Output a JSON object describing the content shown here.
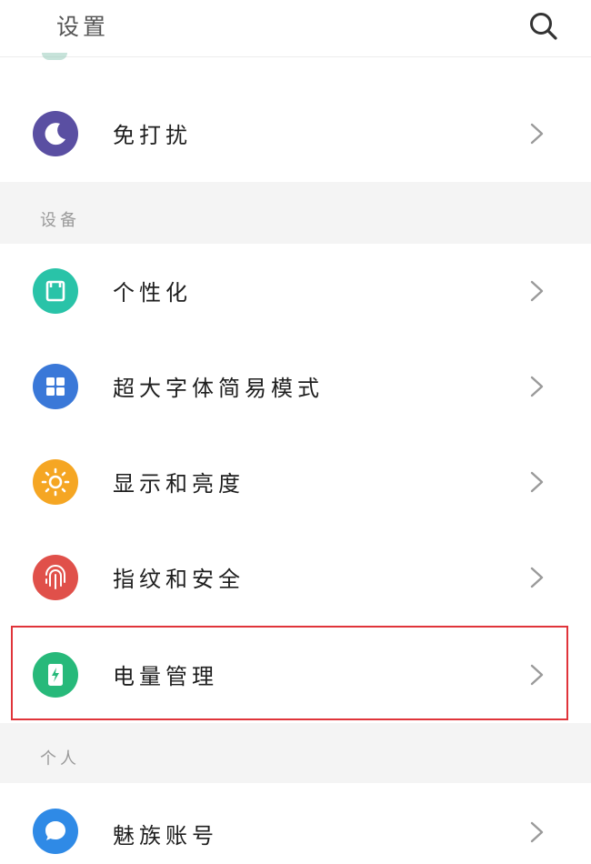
{
  "header": {
    "title": "设置",
    "search_icon": "search-icon"
  },
  "top_rows": [
    {
      "label": "免打扰",
      "icon": "moon-icon",
      "color": "#5a4fa2"
    }
  ],
  "sections": [
    {
      "title": "设备",
      "items": [
        {
          "label": "个性化",
          "icon": "personalize-icon",
          "color": "#29c3a8"
        },
        {
          "label": "超大字体简易模式",
          "icon": "grid-icon",
          "color": "#3a78d8"
        },
        {
          "label": "显示和亮度",
          "icon": "sun-icon",
          "color": "#f5a623"
        },
        {
          "label": "指纹和安全",
          "icon": "fingerprint-icon",
          "color": "#e0504a"
        },
        {
          "label": "电量管理",
          "icon": "battery-icon",
          "color": "#27b97a",
          "highlighted": true
        }
      ]
    },
    {
      "title": "个人",
      "items": [
        {
          "label": "魅族账号",
          "icon": "account-icon",
          "color": "#2f8ae6"
        }
      ]
    }
  ],
  "colors": {
    "highlight_border": "#e0343a",
    "section_bg": "#f4f4f4"
  }
}
